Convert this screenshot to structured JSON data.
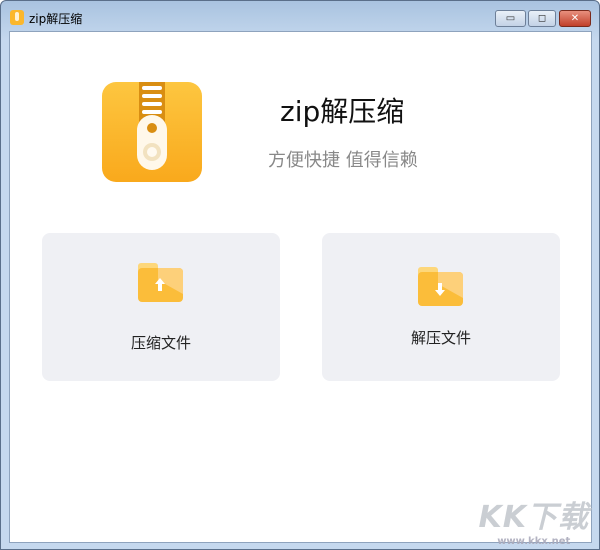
{
  "window": {
    "title": "zip解压缩",
    "minimize_label": "▭",
    "maximize_label": "◻",
    "close_label": "✕"
  },
  "header": {
    "app_name": "zip解压缩",
    "tagline": "方便快捷 值得信赖"
  },
  "actions": [
    {
      "label": "压缩文件",
      "icon": "folder-upload-icon"
    },
    {
      "label": "解压文件",
      "icon": "folder-download-icon"
    }
  ],
  "watermark": {
    "brand": "KK下载",
    "url": "www.kkx.net"
  },
  "colors": {
    "accent": "#fbb72c",
    "card_bg": "#eff0f4",
    "tagline": "#888888"
  }
}
